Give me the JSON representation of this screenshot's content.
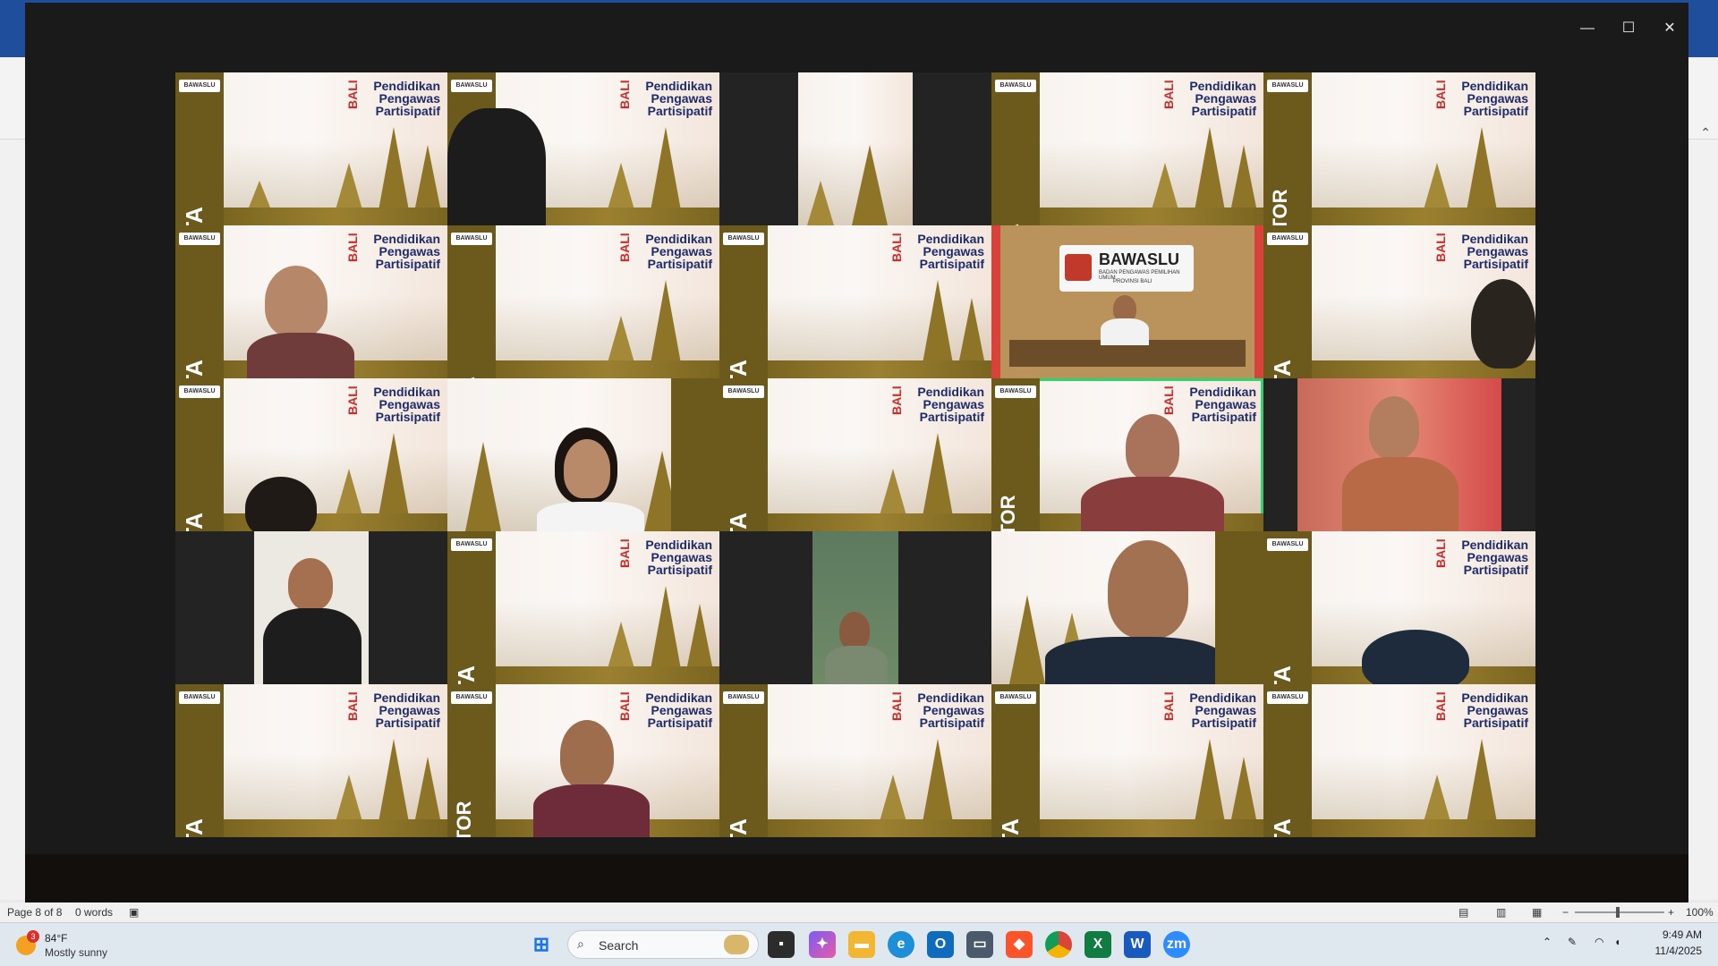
{
  "word": {
    "status_page": "Page 8 of 8",
    "status_words": "0 words",
    "zoom_percent": "100%"
  },
  "zoom_window": {
    "controls": [
      "minimize",
      "maximize",
      "close"
    ]
  },
  "event_banner": {
    "logo": "BAWASLU",
    "title_lines": [
      "Pendidikan",
      "Pengawas",
      "Partisipatif"
    ],
    "region": "BALI"
  },
  "tiles": [
    {
      "role": "PESERTA"
    },
    {
      "role": ""
    },
    {
      "role": ""
    },
    {
      "role": "PANITIA"
    },
    {
      "role": "FASILITATOR"
    },
    {
      "role": "PESERTA"
    },
    {
      "role": "PANITIA"
    },
    {
      "role": "PESERTA"
    },
    {
      "role": ""
    },
    {
      "role": "PESERTA"
    },
    {
      "role": "PESERTA"
    },
    {
      "role": ""
    },
    {
      "role": "PESERTA"
    },
    {
      "role": "FASILITATOR"
    },
    {
      "role": ""
    },
    {
      "role": ""
    },
    {
      "role": "PESERTA"
    },
    {
      "role": ""
    },
    {
      "role": ""
    },
    {
      "role": "PESERTA"
    },
    {
      "role": "PESERTA"
    },
    {
      "role": "FASILITATOR"
    },
    {
      "role": "PESERTA"
    },
    {
      "role": "PESERTA"
    },
    {
      "role": "PESERTA"
    }
  ],
  "bawaslu_room": {
    "logo": "BAWASLU",
    "sub": "BADAN PENGAWAS PEMILIHAN UMUM",
    "province": "PROVINSI BALI"
  },
  "taskbar": {
    "weather_temp": "84°F",
    "weather_desc": "Mostly sunny",
    "weather_badge": "3",
    "search_placeholder": "Search",
    "time": "9:49 AM",
    "date": "11/4/2025"
  }
}
